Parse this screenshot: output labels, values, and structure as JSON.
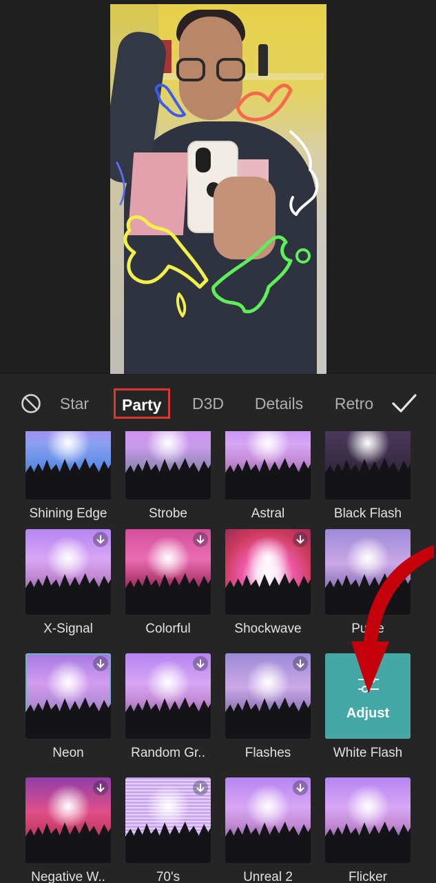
{
  "tabs": {
    "items": [
      {
        "label": "Star"
      },
      {
        "label": "Party"
      },
      {
        "label": "D3D"
      },
      {
        "label": "Details"
      },
      {
        "label": "Retro"
      }
    ],
    "active": "Party"
  },
  "effects": [
    {
      "label": "Shining Edge",
      "download": false,
      "style": "blue"
    },
    {
      "label": "Strobe",
      "download": false,
      "style": "gray"
    },
    {
      "label": "Astral",
      "download": false,
      "style": "purple"
    },
    {
      "label": "Black Flash",
      "download": false,
      "style": "dark"
    },
    {
      "label": "X-Signal",
      "download": true,
      "style": "purple"
    },
    {
      "label": "Colorful",
      "download": true,
      "style": "red"
    },
    {
      "label": "Shockwave",
      "download": true,
      "style": "shock"
    },
    {
      "label": "Pulse",
      "download": false,
      "style": "blur"
    },
    {
      "label": "Neon",
      "download": true,
      "style": "neon"
    },
    {
      "label": "Random Gr..",
      "download": true,
      "style": "purple"
    },
    {
      "label": "Flashes",
      "download": true,
      "style": "blur"
    },
    {
      "label": "White Flash",
      "download": false,
      "style": "adjust"
    },
    {
      "label": "Negative W..",
      "download": true,
      "style": "negative"
    },
    {
      "label": "70's",
      "download": true,
      "style": "lines"
    },
    {
      "label": "Unreal 2",
      "download": true,
      "style": "purple"
    },
    {
      "label": "Flicker",
      "download": false,
      "style": "purple"
    }
  ],
  "adjust": {
    "label": "Adjust"
  },
  "colors": {
    "active_tab_border": "#e0352b",
    "adjust_bg": "#45a8a6",
    "annotation_arrow": "#c4000a"
  },
  "icons": [
    "no-effect-icon",
    "checkmark-icon",
    "download-icon",
    "adjust-sliders-icon"
  ]
}
